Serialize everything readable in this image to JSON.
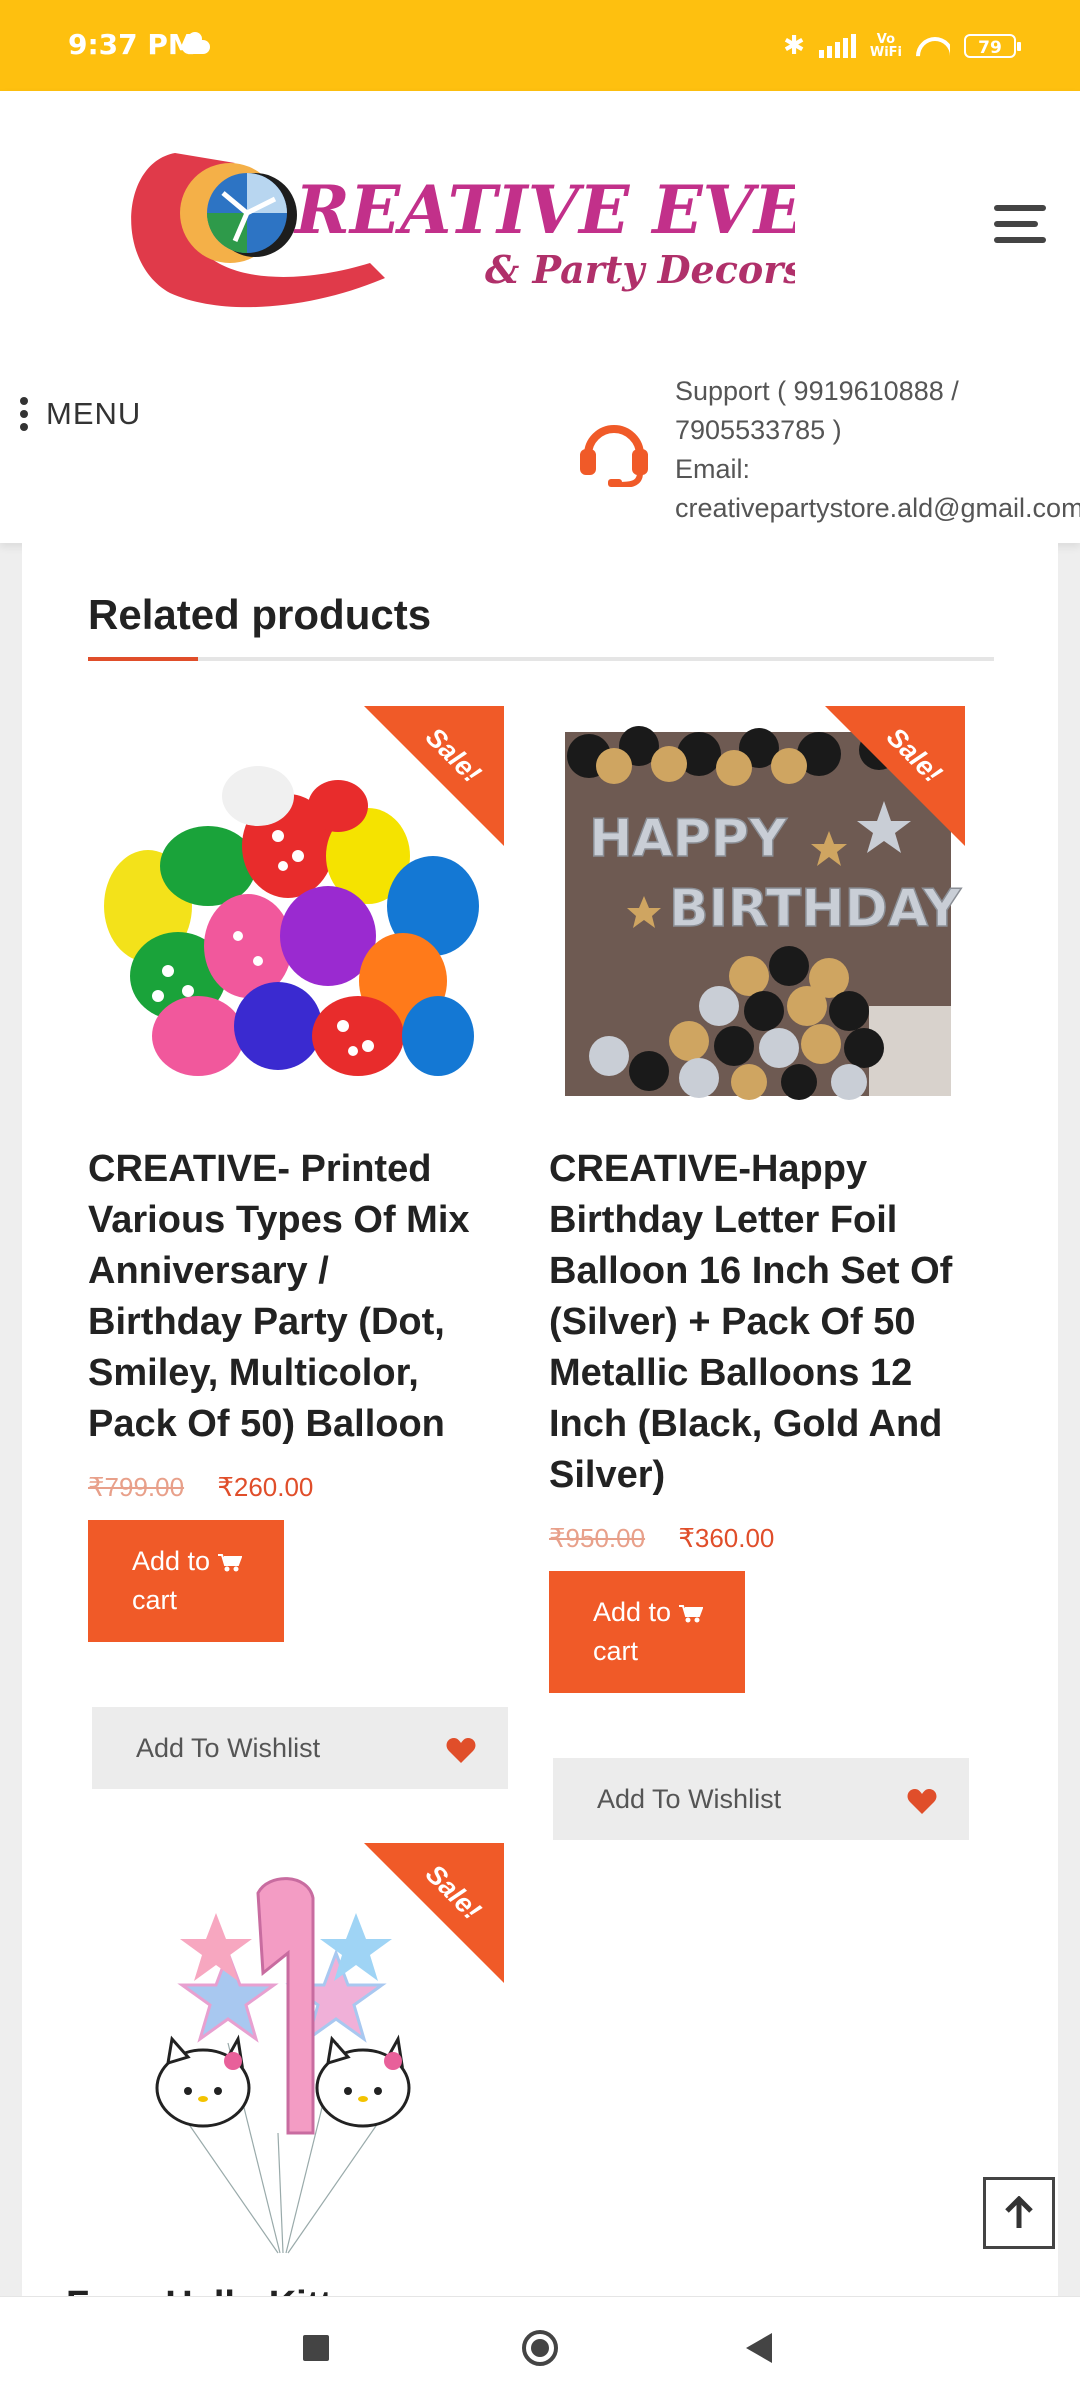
{
  "status_bar": {
    "time": "9:37 PM",
    "battery": "79",
    "vowifi_top": "Vo",
    "vowifi_bottom": "WiFi"
  },
  "header": {
    "logo_main": "REATIVE EVENTS",
    "logo_sub": "& Party Decors",
    "menu_label": "MENU",
    "support_line1": "Support ( 9919610888 /",
    "support_line2": "7905533785 )",
    "email_label": "Email:",
    "email": "creativepartystore.ald@gmail.com"
  },
  "section": {
    "title": "Related products"
  },
  "products": [
    {
      "sale": "Sale!",
      "title_lines": [
        "CREATIVE- Printed",
        "Various Types Of Mix",
        "Anniversary /",
        "Birthday Party (Dot,",
        "Smiley, Multicolor,",
        "Pack Of 50) Balloon"
      ],
      "old_price": "₹799.00",
      "new_price": "₹260.00",
      "cart_line1": "Add to",
      "cart_line2": "cart",
      "wishlist": "Add To Wishlist"
    },
    {
      "sale": "Sale!",
      "title_lines": [
        "CREATIVE-Happy",
        "Birthday Letter Foil",
        "Balloon 16 Inch Set Of",
        "(Silver) + Pack Of 50",
        "Metallic Balloons 12",
        "Inch (Black, Gold And",
        "Silver)"
      ],
      "image_text_1": "HAPPY",
      "image_text_2": "BIRTHDAY",
      "old_price": "₹950.00",
      "new_price": "₹360.00",
      "cart_line1": "Add to",
      "cart_line2": "cart",
      "wishlist": "Add To Wishlist"
    },
    {
      "sale": "Sale!",
      "partial_title": "Foxx Hello Kitty"
    }
  ],
  "colors": {
    "status_bar": "#fec00f",
    "accent": "#f05a28",
    "price": "#e04e2a"
  }
}
